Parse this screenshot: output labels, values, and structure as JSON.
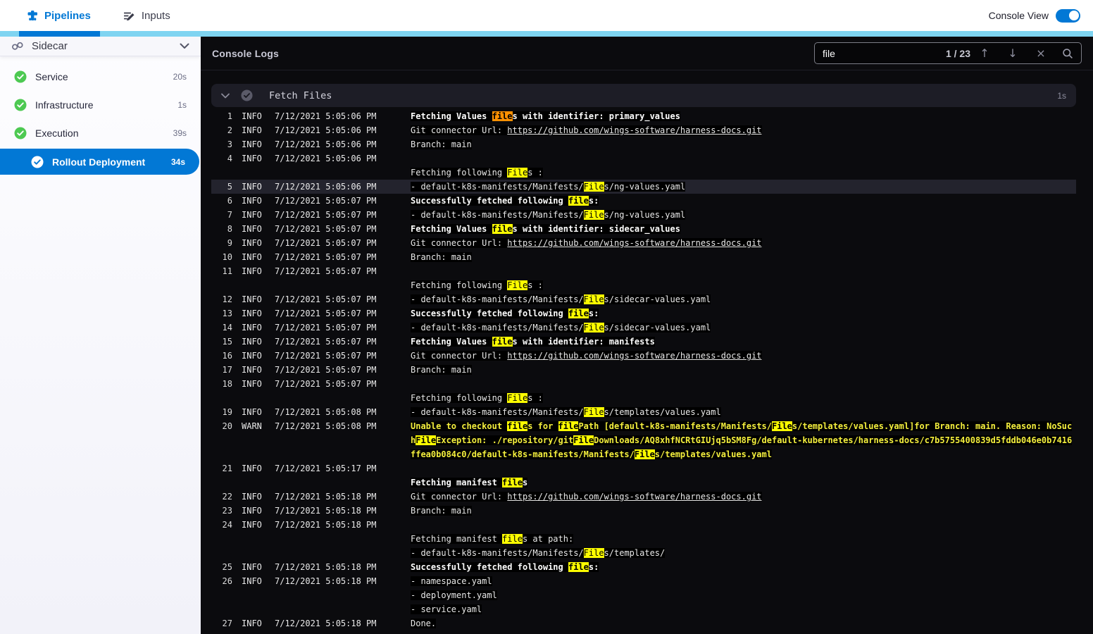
{
  "colors": {
    "primary_blue": "#0278d5",
    "accent_light_blue": "#7fd4f1",
    "success_green": "#4dc952",
    "highlight_yellow": "#fdfd00",
    "current_match_orange": "#ff9102",
    "warn_text_yellow": "#f4ef3d"
  },
  "topbar": {
    "tabs": [
      {
        "label": "Pipelines",
        "active": true
      },
      {
        "label": "Inputs",
        "active": false
      }
    ],
    "console_view_label": "Console View",
    "console_view_on": true
  },
  "sidebar": {
    "title": "Sidecar",
    "items": [
      {
        "label": "Service",
        "duration": "20s",
        "status": "success",
        "selected": false
      },
      {
        "label": "Infrastructure",
        "duration": "1s",
        "status": "success",
        "selected": false
      },
      {
        "label": "Execution",
        "duration": "39s",
        "status": "success",
        "selected": false
      },
      {
        "label": "Rollout Deployment",
        "duration": "34s",
        "status": "success",
        "selected": true
      }
    ]
  },
  "console": {
    "title": "Console Logs",
    "search": {
      "query": "file",
      "match_position": "1 / 23",
      "current_match_index": 1,
      "up_arrow": "↑",
      "down_arrow": "↓",
      "close": "×"
    },
    "section": {
      "title": "Fetch Files",
      "duration": "1s"
    },
    "lines": [
      {
        "num": "1",
        "level": "INFO",
        "time": "7/12/2021 5:05:06 PM",
        "rows": [
          {
            "text": "Fetching Values files with identifier: primary_values",
            "bold": true
          }
        ]
      },
      {
        "num": "2",
        "level": "INFO",
        "time": "7/12/2021 5:05:06 PM",
        "rows": [
          {
            "text": "Git connector Url: ",
            "link": "https://github.com/wings-software/harness-docs.git"
          }
        ]
      },
      {
        "num": "3",
        "level": "INFO",
        "time": "7/12/2021 5:05:06 PM",
        "rows": [
          {
            "text": "Branch: main"
          }
        ]
      },
      {
        "num": "4",
        "level": "INFO",
        "time": "7/12/2021 5:05:06 PM",
        "rows": [
          {
            "text": ""
          },
          {
            "text": "Fetching following Files :"
          }
        ]
      },
      {
        "num": "5",
        "level": "INFO",
        "time": "7/12/2021 5:05:06 PM",
        "active": true,
        "rows": [
          {
            "text": "- default-k8s-manifests/Manifests/Files/ng-values.yaml"
          }
        ]
      },
      {
        "num": "6",
        "level": "INFO",
        "time": "7/12/2021 5:05:07 PM",
        "rows": [
          {
            "text": "Successfully fetched following files:",
            "bold": true
          }
        ]
      },
      {
        "num": "7",
        "level": "INFO",
        "time": "7/12/2021 5:05:07 PM",
        "rows": [
          {
            "text": "- default-k8s-manifests/Manifests/Files/ng-values.yaml"
          }
        ]
      },
      {
        "num": "8",
        "level": "INFO",
        "time": "7/12/2021 5:05:07 PM",
        "rows": [
          {
            "text": "Fetching Values files with identifier: sidecar_values",
            "bold": true
          }
        ]
      },
      {
        "num": "9",
        "level": "INFO",
        "time": "7/12/2021 5:05:07 PM",
        "rows": [
          {
            "text": "Git connector Url: ",
            "link": "https://github.com/wings-software/harness-docs.git"
          }
        ]
      },
      {
        "num": "10",
        "level": "INFO",
        "time": "7/12/2021 5:05:07 PM",
        "rows": [
          {
            "text": "Branch: main"
          }
        ]
      },
      {
        "num": "11",
        "level": "INFO",
        "time": "7/12/2021 5:05:07 PM",
        "rows": [
          {
            "text": ""
          },
          {
            "text": "Fetching following Files :"
          }
        ]
      },
      {
        "num": "12",
        "level": "INFO",
        "time": "7/12/2021 5:05:07 PM",
        "rows": [
          {
            "text": "- default-k8s-manifests/Manifests/Files/sidecar-values.yaml"
          }
        ]
      },
      {
        "num": "13",
        "level": "INFO",
        "time": "7/12/2021 5:05:07 PM",
        "rows": [
          {
            "text": "Successfully fetched following files:",
            "bold": true
          }
        ]
      },
      {
        "num": "14",
        "level": "INFO",
        "time": "7/12/2021 5:05:07 PM",
        "rows": [
          {
            "text": "- default-k8s-manifests/Manifests/Files/sidecar-values.yaml"
          }
        ]
      },
      {
        "num": "15",
        "level": "INFO",
        "time": "7/12/2021 5:05:07 PM",
        "rows": [
          {
            "text": "Fetching Values files with identifier: manifests",
            "bold": true
          }
        ]
      },
      {
        "num": "16",
        "level": "INFO",
        "time": "7/12/2021 5:05:07 PM",
        "rows": [
          {
            "text": "Git connector Url: ",
            "link": "https://github.com/wings-software/harness-docs.git"
          }
        ]
      },
      {
        "num": "17",
        "level": "INFO",
        "time": "7/12/2021 5:05:07 PM",
        "rows": [
          {
            "text": "Branch: main"
          }
        ]
      },
      {
        "num": "18",
        "level": "INFO",
        "time": "7/12/2021 5:05:07 PM",
        "rows": [
          {
            "text": ""
          },
          {
            "text": "Fetching following Files :"
          }
        ]
      },
      {
        "num": "19",
        "level": "INFO",
        "time": "7/12/2021 5:05:08 PM",
        "rows": [
          {
            "text": "- default-k8s-manifests/Manifests/Files/templates/values.yaml"
          }
        ]
      },
      {
        "num": "20",
        "level": "WARN",
        "time": "7/12/2021 5:05:08 PM",
        "rows": [
          {
            "text": "Unable to checkout files for filePath [default-k8s-manifests/Manifests/Files/templates/values.yaml]for Branch: main. Reason: NoSuchFileException: ./repository/gitFileDownloads/AQ8xhfNCRtGIUjq5bSM8Fg/default-kubernetes/harness-docs/c7b5755400839d5fddb046e0b7416ffea0b084c0/default-k8s-manifests/Manifests/Files/templates/values.yaml",
            "warn": true
          }
        ]
      },
      {
        "num": "21",
        "level": "INFO",
        "time": "7/12/2021 5:05:17 PM",
        "rows": [
          {
            "text": ""
          },
          {
            "text": "Fetching manifest files",
            "bold": true
          }
        ]
      },
      {
        "num": "22",
        "level": "INFO",
        "time": "7/12/2021 5:05:18 PM",
        "rows": [
          {
            "text": "Git connector Url: ",
            "link": "https://github.com/wings-software/harness-docs.git"
          }
        ]
      },
      {
        "num": "23",
        "level": "INFO",
        "time": "7/12/2021 5:05:18 PM",
        "rows": [
          {
            "text": "Branch: main"
          }
        ]
      },
      {
        "num": "24",
        "level": "INFO",
        "time": "7/12/2021 5:05:18 PM",
        "rows": [
          {
            "text": ""
          },
          {
            "text": "Fetching manifest files at path:"
          },
          {
            "text": "- default-k8s-manifests/Manifests/Files/templates/"
          }
        ]
      },
      {
        "num": "25",
        "level": "INFO",
        "time": "7/12/2021 5:05:18 PM",
        "rows": [
          {
            "text": "Successfully fetched following files:",
            "bold": true
          }
        ]
      },
      {
        "num": "26",
        "level": "INFO",
        "time": "7/12/2021 5:05:18 PM",
        "rows": [
          {
            "text": "- namespace.yaml"
          },
          {
            "text": "- deployment.yaml"
          },
          {
            "text": "- service.yaml"
          }
        ]
      },
      {
        "num": "27",
        "level": "INFO",
        "time": "7/12/2021 5:05:18 PM",
        "rows": [
          {
            "text": "Done."
          }
        ]
      }
    ]
  }
}
